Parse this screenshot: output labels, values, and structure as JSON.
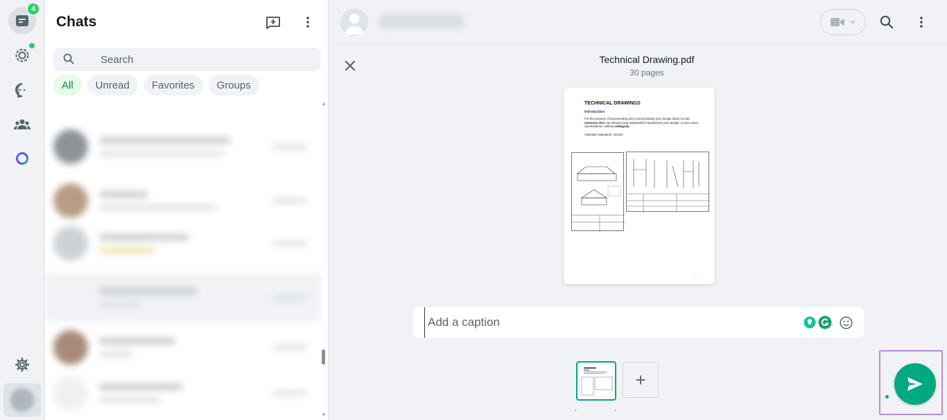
{
  "rail": {
    "chats_badge": "4",
    "items": [
      {
        "name": "chats",
        "icon": "chats-icon"
      },
      {
        "name": "status",
        "icon": "status-icon"
      },
      {
        "name": "channels",
        "icon": "channels-icon"
      },
      {
        "name": "communities",
        "icon": "communities-icon"
      },
      {
        "name": "meta-ai",
        "icon": "meta-ai-icon"
      },
      {
        "name": "settings",
        "icon": "gear-icon"
      }
    ]
  },
  "list": {
    "title": "Chats",
    "search_placeholder": "Search",
    "filters": [
      "All",
      "Unread",
      "Favorites",
      "Groups"
    ],
    "active_filter": "All"
  },
  "preview": {
    "file_name": "Technical Drawing.pdf",
    "page_count": "30 pages",
    "doc": {
      "heading": "TECHNICAL DRAWINGS",
      "subheading": "Introduction",
      "paragraph_prefix": "For the purpose of documenting and communicating your design ideas so that ",
      "paragraph_bold1": "someone else",
      "paragraph_mid": " can interpret and make/build/ manufacture your design, to your exact specifications, without ",
      "paragraph_bold2": "ambiguity",
      "standards": "Australian Standards:  AS1100"
    },
    "caption_placeholder": "Add a caption"
  },
  "colors": {
    "accent": "#00a884",
    "badge": "#25d366",
    "highlight_frame": "#b48ce0"
  }
}
